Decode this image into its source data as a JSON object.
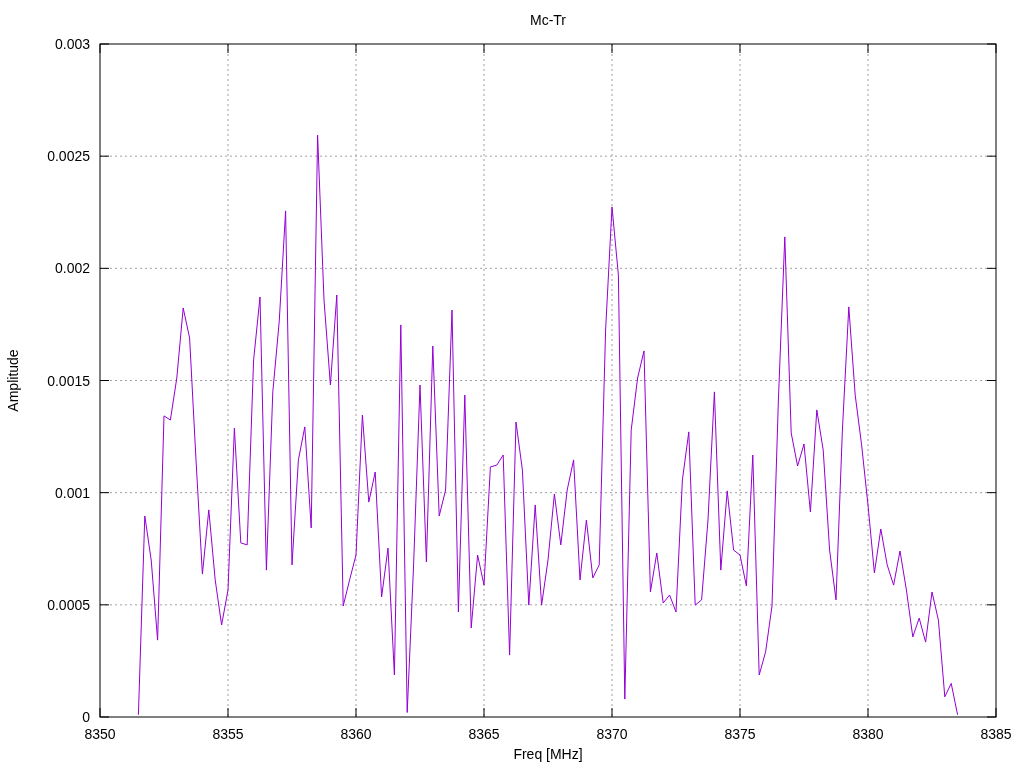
{
  "chart": {
    "chart_data": {
      "type": "line",
      "title": "Mc-Tr",
      "xlabel": "Freq [MHz]",
      "ylabel": "Amplitude",
      "xlim": [
        8350,
        8385
      ],
      "ylim": [
        0,
        0.003
      ],
      "grid": true,
      "xticks": [
        8350,
        8355,
        8360,
        8365,
        8370,
        8375,
        8380,
        8385
      ],
      "yticks": [
        0,
        0.0005,
        0.001,
        0.0015,
        0.002,
        0.0025,
        0.003
      ],
      "x": [
        8351.5,
        8351.75,
        8352,
        8352.25,
        8352.5,
        8352.75,
        8353,
        8353.25,
        8353.5,
        8353.75,
        8354,
        8354.25,
        8354.5,
        8354.75,
        8355,
        8355.25,
        8355.5,
        8355.75,
        8356,
        8356.25,
        8356.5,
        8356.75,
        8357,
        8357.25,
        8357.5,
        8357.75,
        8358,
        8358.25,
        8358.5,
        8358.75,
        8359,
        8359.25,
        8359.5,
        8359.75,
        8360,
        8360.25,
        8360.5,
        8360.75,
        8361,
        8361.25,
        8361.5,
        8361.75,
        8362,
        8362.25,
        8362.5,
        8362.75,
        8363,
        8363.25,
        8363.5,
        8363.75,
        8364,
        8364.25,
        8364.5,
        8364.75,
        8365,
        8365.25,
        8365.5,
        8365.75,
        8366,
        8366.25,
        8366.5,
        8366.75,
        8367,
        8367.25,
        8367.5,
        8367.75,
        8368,
        8368.25,
        8368.5,
        8368.75,
        8369,
        8369.25,
        8369.5,
        8369.75,
        8370,
        8370.25,
        8370.5,
        8370.75,
        8371,
        8371.25,
        8371.5,
        8371.75,
        8372,
        8372.25,
        8372.5,
        8372.75,
        8373,
        8373.25,
        8373.5,
        8373.75,
        8374,
        8374.25,
        8374.5,
        8374.75,
        8375,
        8375.25,
        8375.5,
        8375.75,
        8376,
        8376.25,
        8376.5,
        8376.75,
        8377,
        8377.25,
        8377.5,
        8377.75,
        8378,
        8378.25,
        8378.5,
        8378.75,
        8379,
        8379.25,
        8379.5,
        8379.75,
        8380,
        8380.25,
        8380.5,
        8380.75,
        8381,
        8381.25,
        8381.5,
        8381.75,
        8382,
        8382.25,
        8382.5,
        8382.75,
        8383,
        8383.25,
        8383.5
      ],
      "series": [
        {
          "color": "#9400d3",
          "values": [
            1e-05,
            0.000896,
            0.0007,
            0.000343,
            0.001342,
            0.001324,
            0.001511,
            0.001823,
            0.00169,
            0.001146,
            0.000637,
            0.000923,
            0.000611,
            0.00041,
            0.000566,
            0.001288,
            0.000776,
            0.000767,
            0.001592,
            0.001872,
            0.000655,
            0.001449,
            0.001761,
            0.002256,
            0.000678,
            0.001146,
            0.001293,
            0.000843,
            0.002594,
            0.001859,
            0.00148,
            0.001881,
            0.000495,
            0.000611,
            0.000722,
            0.001346,
            0.000958,
            0.001092,
            0.000535,
            0.000753,
            0.000187,
            0.001748,
            2e-05,
            0.000678,
            0.00148,
            0.000691,
            0.001654,
            0.000896,
            0.001012,
            0.001814,
            0.000468,
            0.001435,
            0.000397,
            0.000722,
            0.000588,
            0.001115,
            0.001123,
            0.001168,
            0.000276,
            0.001315,
            0.001101,
            0.000499,
            0.000945,
            0.000499,
            0.0007,
            0.000994,
            0.000767,
            0.001012,
            0.001146,
            0.000611,
            0.000878,
            0.00062,
            0.000678,
            0.001725,
            0.002274,
            0.00197,
            8e-05,
            0.001279,
            0.001511,
            0.001632,
            0.000557,
            0.000731,
            0.000508,
            0.000544,
            0.000468,
            0.001057,
            0.001271,
            0.000499,
            0.000522,
            0.000878,
            0.001449,
            0.000655,
            0.001008,
            0.000744,
            0.000722,
            0.000584,
            0.001168,
            0.000187,
            0.00029,
            0.000495,
            0.001413,
            0.00214,
            0.001266,
            0.001119,
            0.001217,
            0.000914,
            0.001369,
            0.00119,
            0.000744,
            0.000522,
            0.001279,
            0.001828,
            0.001435,
            0.001213,
            0.000945,
            0.000642,
            0.000838,
            0.000678,
            0.000588,
            0.00074,
            0.000566,
            0.000357,
            0.000441,
            0.000334,
            0.000557,
            0.000432,
            9e-05,
            0.00015,
            1e-05
          ]
        }
      ]
    }
  }
}
